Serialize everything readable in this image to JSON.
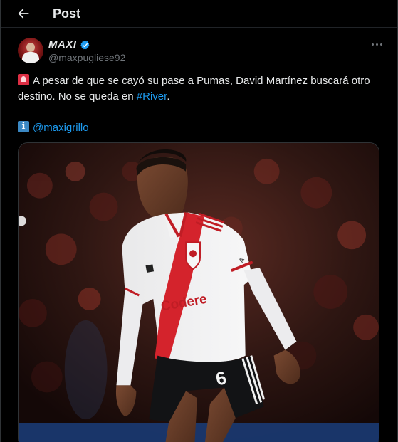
{
  "header": {
    "title": "Post"
  },
  "author": {
    "display_name": "MAXI",
    "handle": "@maxpugliese92"
  },
  "tweet": {
    "line1_text": "A pesar de que se cayó su pase a Pumas, David Martínez buscará otro destino. No se queda en ",
    "hashtag": "#River",
    "line1_end": ".",
    "mention": "@maxigrillo",
    "emoji1": "siren-emoji",
    "emoji2": "information-emoji"
  },
  "media": {
    "jersey_sponsor": "Codere",
    "jersey_number": "6",
    "jersey_brand_text": "adidas"
  },
  "colors": {
    "background": "#000000",
    "text": "#e7e9ea",
    "secondary": "#71767b",
    "link": "#1d9bf0",
    "verified": "#1d9bf0",
    "border": "#2f3336"
  }
}
